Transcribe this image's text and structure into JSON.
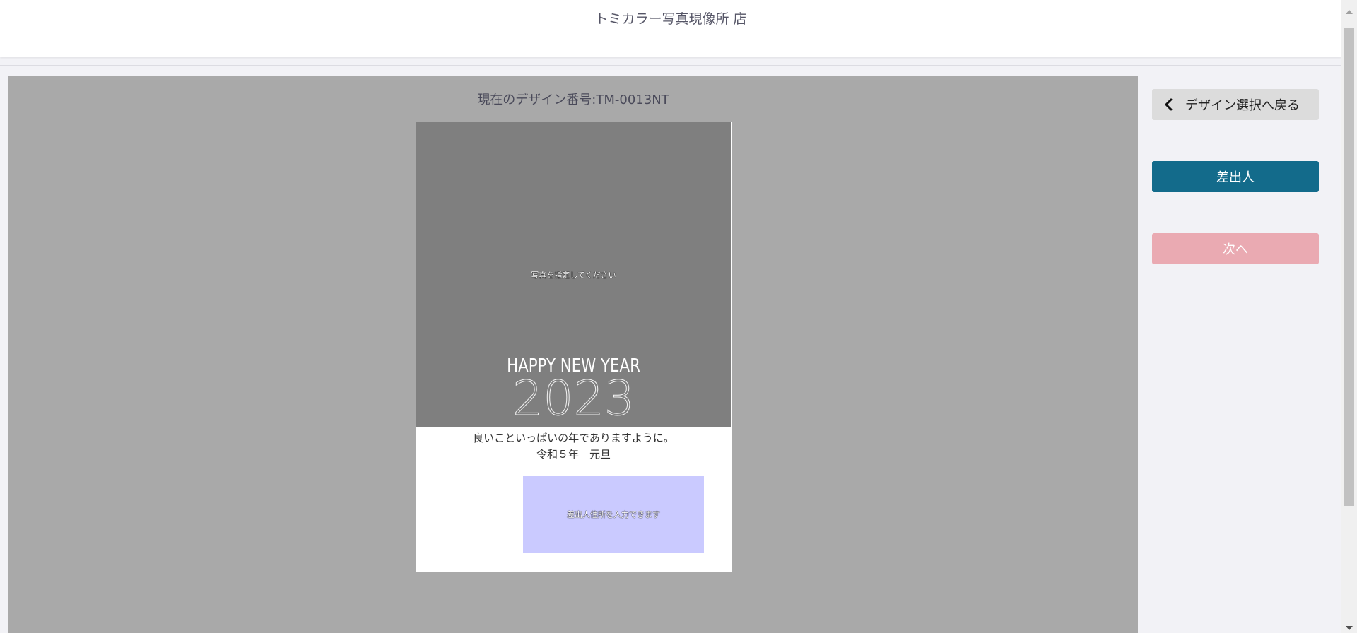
{
  "header": {
    "title": "トミカラー写真現像所 店"
  },
  "editor": {
    "design_number": "現在のデザイン番号:TM-0013NT"
  },
  "card": {
    "photo_placeholder": "写真を指定してください",
    "happy_new_year": "HAPPY NEW YEAR",
    "year": "2023",
    "greeting_line1": "良いこといっぱいの年でありますように。",
    "greeting_line2": "令和５年　元旦",
    "sender_placeholder": "差出人住所を入力できます"
  },
  "sidebar": {
    "back_label": "デザイン選択へ戻る",
    "sender_label": "差出人",
    "next_label": "次へ"
  },
  "colors": {
    "primary": "#136b8b",
    "next_disabled": "#eaaab2",
    "sender_box": "#cacaff",
    "canvas_bg": "#a9a9a9"
  },
  "icons": {
    "back": "chevron-left-icon"
  }
}
